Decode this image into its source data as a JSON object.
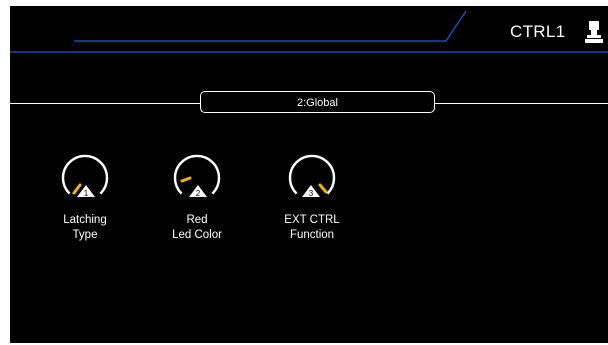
{
  "header": {
    "device_name": "CTRL1",
    "device_icon": "pedal-icon",
    "accent_color": "#1e5bd6"
  },
  "page_tab": {
    "label": "2:Global"
  },
  "knobs": [
    {
      "number": "1",
      "label_line1": "Latching",
      "label_line2": "Type",
      "indicator_color": "#f0b400"
    },
    {
      "number": "2",
      "label_line1": "Red",
      "label_line2": "Led Color",
      "indicator_color": "#f0b400"
    },
    {
      "number": "3",
      "label_line1": "EXT CTRL",
      "label_line2": "Function",
      "indicator_color": "#f0b400"
    }
  ]
}
